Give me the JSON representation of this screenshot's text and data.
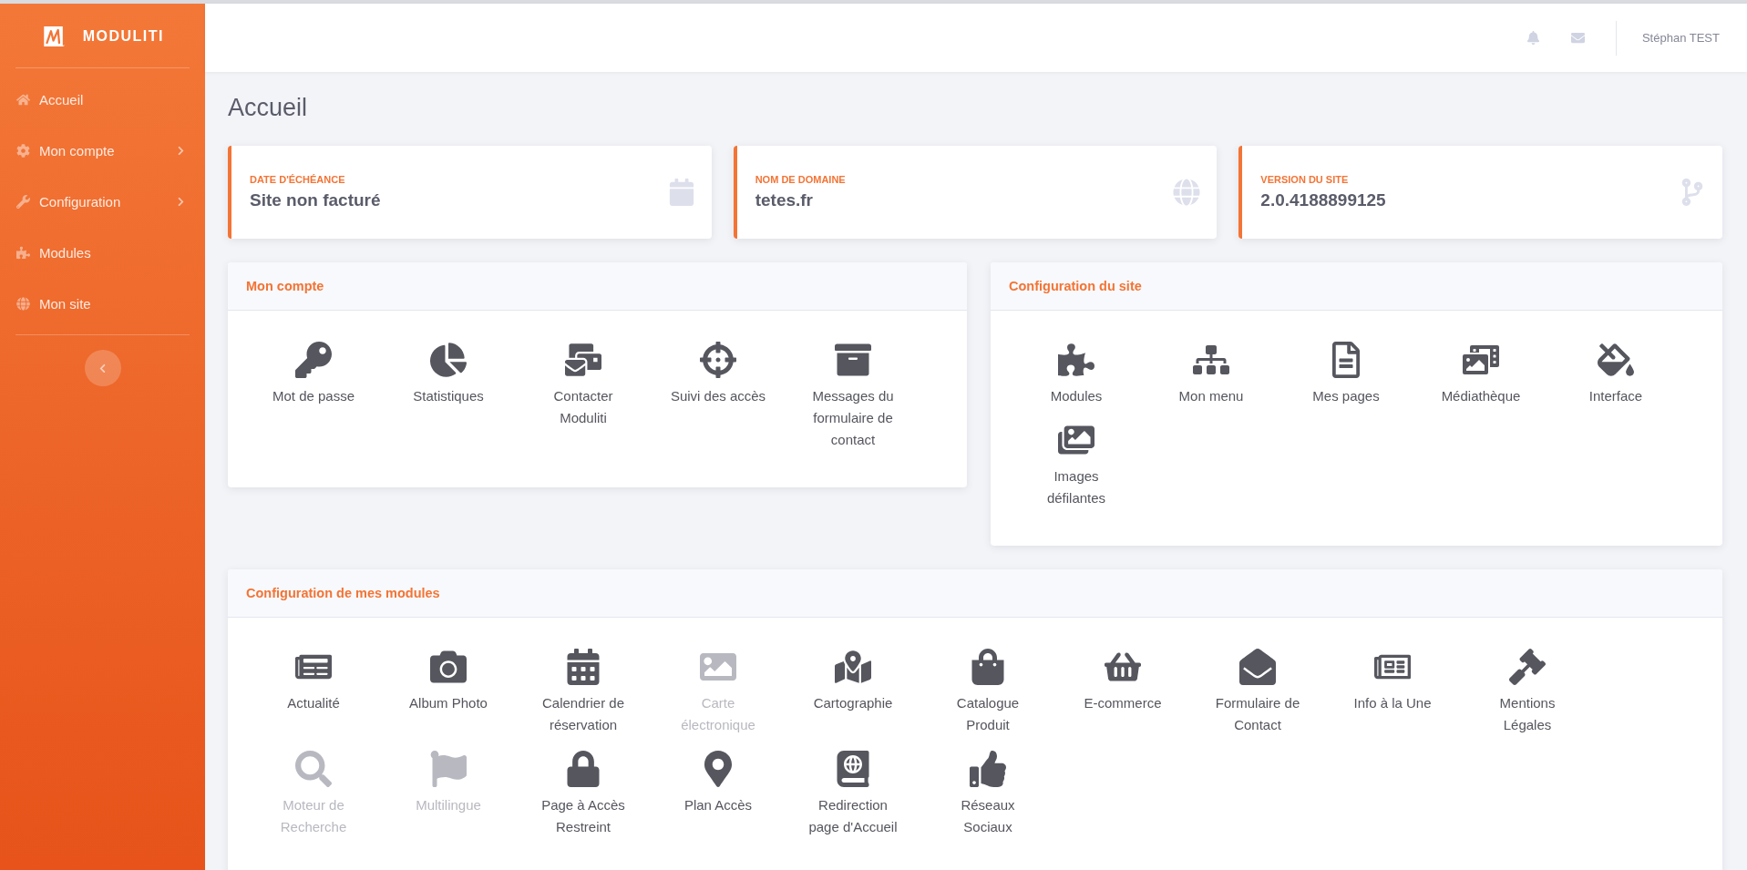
{
  "sidebar": {
    "brand": "MODULITI",
    "items": [
      {
        "label": "Accueil",
        "has_submenu": false
      },
      {
        "label": "Mon compte",
        "has_submenu": true
      },
      {
        "label": "Configuration",
        "has_submenu": true
      },
      {
        "label": "Modules",
        "has_submenu": false
      },
      {
        "label": "Mon site",
        "has_submenu": false
      }
    ]
  },
  "header": {
    "user": "Stéphan TEST"
  },
  "page_title": "Accueil",
  "info_cards": [
    {
      "label": "DATE D'ÉCHÉANCE",
      "value": "Site non facturé"
    },
    {
      "label": "NOM DE DOMAINE",
      "value": "tetes.fr"
    },
    {
      "label": "VERSION DU SITE",
      "value": "2.0.4188899125"
    }
  ],
  "panels": [
    {
      "title": "Mon compte",
      "items": [
        {
          "label": "Mot de passe",
          "disabled": false
        },
        {
          "label": "Statistiques",
          "disabled": false
        },
        {
          "label": "Contacter Moduliti",
          "disabled": false
        },
        {
          "label": "Suivi des accès",
          "disabled": false
        },
        {
          "label": "Messages du formulaire de contact",
          "disabled": false
        }
      ]
    },
    {
      "title": "Configuration du site",
      "items": [
        {
          "label": "Modules",
          "disabled": false
        },
        {
          "label": "Mon menu",
          "disabled": false
        },
        {
          "label": "Mes pages",
          "disabled": false
        },
        {
          "label": "Médiathèque",
          "disabled": false
        },
        {
          "label": "Interface",
          "disabled": false
        },
        {
          "label": "Images défilantes",
          "disabled": false
        }
      ]
    },
    {
      "title": "Configuration de mes modules",
      "items": [
        {
          "label": "Actualité",
          "disabled": false
        },
        {
          "label": "Album Photo",
          "disabled": false
        },
        {
          "label": "Calendrier de réservation",
          "disabled": false
        },
        {
          "label": "Carte électronique",
          "disabled": true
        },
        {
          "label": "Cartographie",
          "disabled": false
        },
        {
          "label": "Catalogue Produit",
          "disabled": false
        },
        {
          "label": "E-commerce",
          "disabled": false
        },
        {
          "label": "Formulaire de Contact",
          "disabled": false
        },
        {
          "label": "Info à la Une",
          "disabled": false
        },
        {
          "label": "Mentions Légales",
          "disabled": false
        },
        {
          "label": "Moteur de Recherche",
          "disabled": true
        },
        {
          "label": "Multilingue",
          "disabled": true
        },
        {
          "label": "Page à Accès Restreint",
          "disabled": false
        },
        {
          "label": "Plan Accès",
          "disabled": false
        },
        {
          "label": "Redirection page d'Accueil",
          "disabled": false
        },
        {
          "label": "Réseaux Sociaux",
          "disabled": false
        }
      ]
    }
  ]
}
